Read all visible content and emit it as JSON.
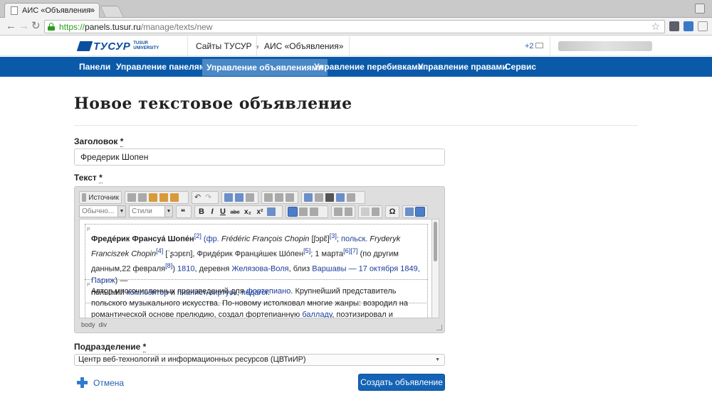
{
  "browser": {
    "tab_title": "АИС «Объявления»",
    "url_scheme": "https://",
    "url_host": "panels.tusur.ru",
    "url_path": "/manage/texts/new"
  },
  "site": {
    "logo_text": "ТУСУР",
    "logo_sub_1": "TUSUR",
    "logo_sub_2": "UNIVERSITY",
    "sites_link": "Сайты ТУСУР",
    "app_link": "АИС «Объявления»",
    "notifications_count": "+2"
  },
  "nav": [
    {
      "label": "Панели",
      "active": false
    },
    {
      "label": "Управление панелями",
      "active": false
    },
    {
      "label": "Управление объявлениями",
      "active": true
    },
    {
      "label": "Управление перебивками",
      "active": false
    },
    {
      "label": "Управление правами",
      "active": false
    },
    {
      "label": "Сервис",
      "active": false
    }
  ],
  "page": {
    "title": "Новое текстовое объявление"
  },
  "form": {
    "title_label": "Заголовок",
    "title_value": "Фредерик Шопен",
    "required_mark": "*",
    "text_label": "Текст",
    "division_label": "Подразделение",
    "division_value": "Центр веб-технологий и информационных ресурсов (ЦВТиИР)",
    "cancel_label": "Отмена",
    "submit_label": "Создать объявление"
  },
  "editor": {
    "source_label": "Источник",
    "format_combo": "Обычно...",
    "style_combo": "Стили",
    "quote_btn": "❝",
    "bold_btn": "B",
    "italic_btn": "I",
    "underline_btn": "U",
    "strike_btn": "abc",
    "subscript_btn": "x₂",
    "superscript_btn": "x²",
    "omega_btn": "Ω",
    "path_body": "body",
    "path_div": "div",
    "para_tag": "P",
    "p1": {
      "name": "Фреде́рик Франсуа́ Шопе́н",
      "r2": "[2]",
      "open": " (",
      "fr": "фр.",
      "fr_name": " Frédéric François Chopin",
      "ipa1": " [ʃɔpɛ̃]",
      "r3": "[3]",
      "sep1": "; ",
      "pl": "польск.",
      "pl_name": " Fryderyk Franciszek Chopin",
      "r4": "[4]",
      "ipa2": " [ˈʂɔpɛn], Фриде́рик Франци́шек Шо́пен",
      "r5": "[5]",
      "date1": "; 1 марта",
      "r6": "[6]",
      "r7": "[7]",
      "alt": " (по другим данным,22 февраля",
      "r8": "[8]",
      "close": ") ",
      "year1": "1810",
      "comma": ", деревня ",
      "village": "Желязова-Воля",
      "near": ", близ ",
      "warsaw": "Варшавы",
      "dash1": " — ",
      "death_date": "17 октября",
      "space": " ",
      "year2": "1849",
      "comma2": ", ",
      "paris": "Париж",
      "dash2": ") —",
      "polish": "польский ",
      "composer": "композитор",
      "and": " и ",
      "pianist": "пианист-виртуоз",
      "comma3": ", ",
      "teacher": "педагог",
      "dot": "."
    },
    "p2": {
      "t1": "Автор многочисленных произведений для ",
      "piano": "фортепиано",
      "t2": ". Крупнейший представитель польского музыкального искусства. По-новому истолковал многие жанры: возродил на романтической основе прелюдию, создал фортепианную ",
      "ballad": "балладу",
      "t3": ", поэтизировал и драматизировал"
    }
  }
}
